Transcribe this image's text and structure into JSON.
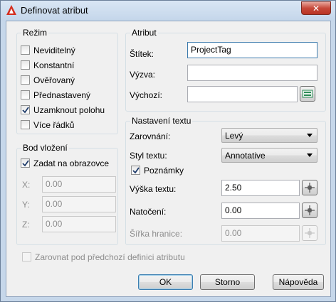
{
  "window": {
    "title": "Definovat atribut",
    "close_glyph": "✕"
  },
  "mode": {
    "legend": "Režim",
    "items": [
      {
        "label": "Neviditelný",
        "checked": false
      },
      {
        "label": "Konstantní",
        "checked": false
      },
      {
        "label": "Ověřovaný",
        "checked": false
      },
      {
        "label": "Přednastavený",
        "checked": false
      },
      {
        "label": "Uzamknout polohu",
        "checked": true
      },
      {
        "label": "Více řádků",
        "checked": false
      }
    ]
  },
  "insertion": {
    "legend": "Bod vložení",
    "specify_label": "Zadat na obrazovce",
    "specify_checked": true,
    "x_label": "X:",
    "x_value": "0.00",
    "y_label": "Y:",
    "y_value": "0.00",
    "z_label": "Z:",
    "z_value": "0.00"
  },
  "attribute": {
    "legend": "Atribut",
    "tag_label": "Štítek:",
    "tag_value": "ProjectTag",
    "prompt_label": "Výzva:",
    "prompt_value": "",
    "default_label": "Výchozí:",
    "default_value": "",
    "insert_field_icon": "insert-field-icon"
  },
  "text_settings": {
    "legend": "Nastavení textu",
    "justification_label": "Zarovnání:",
    "justification_value": "Levý",
    "style_label": "Styl textu:",
    "style_value": "Annotative",
    "annotative_label": "Poznámky",
    "annotative_checked": true,
    "height_label": "Výška textu:",
    "height_value": "2.50",
    "rotation_label": "Natočení:",
    "rotation_value": "0.00",
    "boundary_label": "Šířka hranice:",
    "boundary_value": "0.00"
  },
  "align_below": {
    "label": "Zarovnat pod předchozí definici atributu",
    "checked": false
  },
  "buttons": {
    "ok": "OK",
    "cancel": "Storno",
    "help": "Nápověda"
  },
  "colors": {
    "titlebar": "#c4d6ea",
    "close_button": "#c7493a",
    "dialog_bg": "#f0f0f0",
    "icon_red": "#d42d1e",
    "field_icon_green": "#2e8b57"
  }
}
